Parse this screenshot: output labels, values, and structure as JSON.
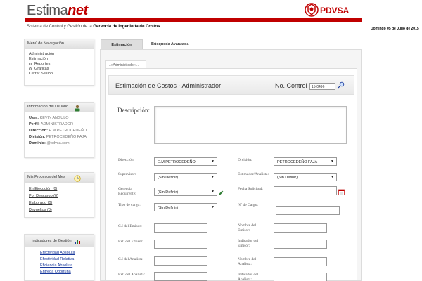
{
  "header": {
    "logo_part1": "Estima",
    "logo_part2": "net",
    "brand": "PDVSA",
    "subtitle_prefix": "Sistema de Control y Gestión de la",
    "subtitle_bold": "Gerencia de Ingeniería de Costos.",
    "date": "Domingo 05 de Julio de 2015"
  },
  "sidebar": {
    "nav_title": "Menú de Navegación",
    "nav_items": [
      "Administración",
      "Estimación",
      "Reportes",
      "Graficas",
      "Cerrar Sesión"
    ],
    "user_title": "Información del Usuario",
    "user": {
      "user_label": "User:",
      "user_value": "KEVIN ANGULO",
      "profile_label": "Perfil:",
      "profile_value": "ADMINISTRADOR",
      "dir_label": "Dirección:",
      "dir_value": "E.M PETROCEDEÑO",
      "div_label": "División:",
      "div_value": "PETROCEDEÑO FAJA",
      "domain_label": "Dominio:",
      "domain_value": "@pdvsa.com"
    },
    "procs_title": "Mis Procesos del Mes",
    "procs": [
      "En Ejecución (0)",
      "Por Descargo (0)",
      "Elaborado (0)",
      "Devueltos (0)"
    ],
    "ind_title": "Indicadores de Gestión:",
    "indicators": [
      "Efectividad Absoluta",
      "Efectividad Relativa",
      "Eficiencia Absoluta",
      "Entrega Oportuna"
    ]
  },
  "tabs": {
    "estimacion": "Estimación",
    "busqueda": "Búsqueda Avanzada"
  },
  "form": {
    "admin_tab": "..::Administrador::..",
    "title": "Estimación de Costos - Administrador",
    "control_label": "No. Control :",
    "control_value": "15-0496",
    "desc_label": "Descripción:",
    "direccion_label": "Dirección:",
    "direccion_value": "E.M PETROCEDEÑO",
    "division_label": "División:",
    "division_value": "PETROCEDEÑO FAJA",
    "supervisor_label": "Supervisor:",
    "supervisor_value": "(Sin Definir)",
    "estimador_label": "Estimador/Analista:",
    "estimador_value": "(Sin Definir)",
    "gerencia_label": "Gerencia Requirente:",
    "gerencia_value": "(Sin Definir)",
    "fecha_label": "Fecha Solicitud:",
    "tipo_label": "Tipo de cargo:",
    "tipo_value": "(Sin Definir)",
    "ncargo_label": "N° de Cargo:",
    "ci_emisor_label": "C.I del Emisor:",
    "nombre_emisor_label": "Nombre del Emisor:",
    "ext_emisor_label": "Ext. del Emisor:",
    "ind_emisor_label": "Indicador del Emisor:",
    "ci_analista_label": "C.I del Analista:",
    "nombre_analista_label": "Nombre del Analista:",
    "ext_analista_label": "Ext. del Analista:",
    "ind_analista_label": "Indicador del Analista:"
  },
  "colors": {
    "brand_red": "#c00000",
    "link_blue": "#1a3a9c"
  }
}
